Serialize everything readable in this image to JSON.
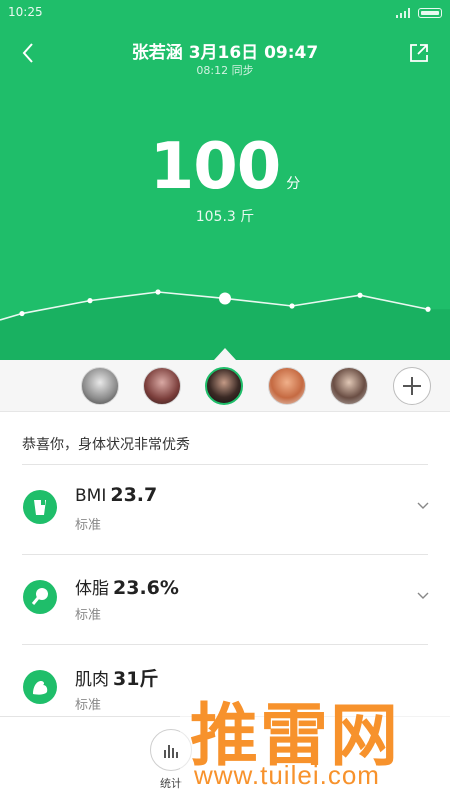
{
  "statusbar": {
    "time": "10:25"
  },
  "header": {
    "title": "张若涵 3月16日 09:47",
    "sync": "08:12 同步",
    "back_icon": "chevron-left-icon",
    "share_icon": "share-icon"
  },
  "score": {
    "value": "100",
    "unit": "分",
    "weight": "105.3 斤"
  },
  "trend": {
    "points": [
      20,
      26,
      38,
      46,
      40,
      33,
      43,
      30
    ],
    "selected_index": 4
  },
  "avatars": [
    {
      "name": "user-1",
      "selected": false
    },
    {
      "name": "user-2",
      "selected": false
    },
    {
      "name": "user-3",
      "selected": true
    },
    {
      "name": "user-4",
      "selected": false
    },
    {
      "name": "user-5",
      "selected": false
    }
  ],
  "summary": "恭喜你，身体状况非常优秀",
  "metrics": [
    {
      "name": "BMI",
      "value": "23.7",
      "status": "标准",
      "icon": "cup-icon"
    },
    {
      "name": "体脂",
      "value": "23.6%",
      "status": "标准",
      "icon": "drumstick-icon"
    },
    {
      "name": "肌肉",
      "value": "31斤",
      "status": "标准",
      "icon": "muscle-icon"
    }
  ],
  "bottom": {
    "stats_label": "统计"
  },
  "watermark": {
    "logo": "推雷网",
    "url": "www.tuilei.com"
  },
  "colors": {
    "accent": "#1fbe6a",
    "watermark": "#f7922c"
  }
}
